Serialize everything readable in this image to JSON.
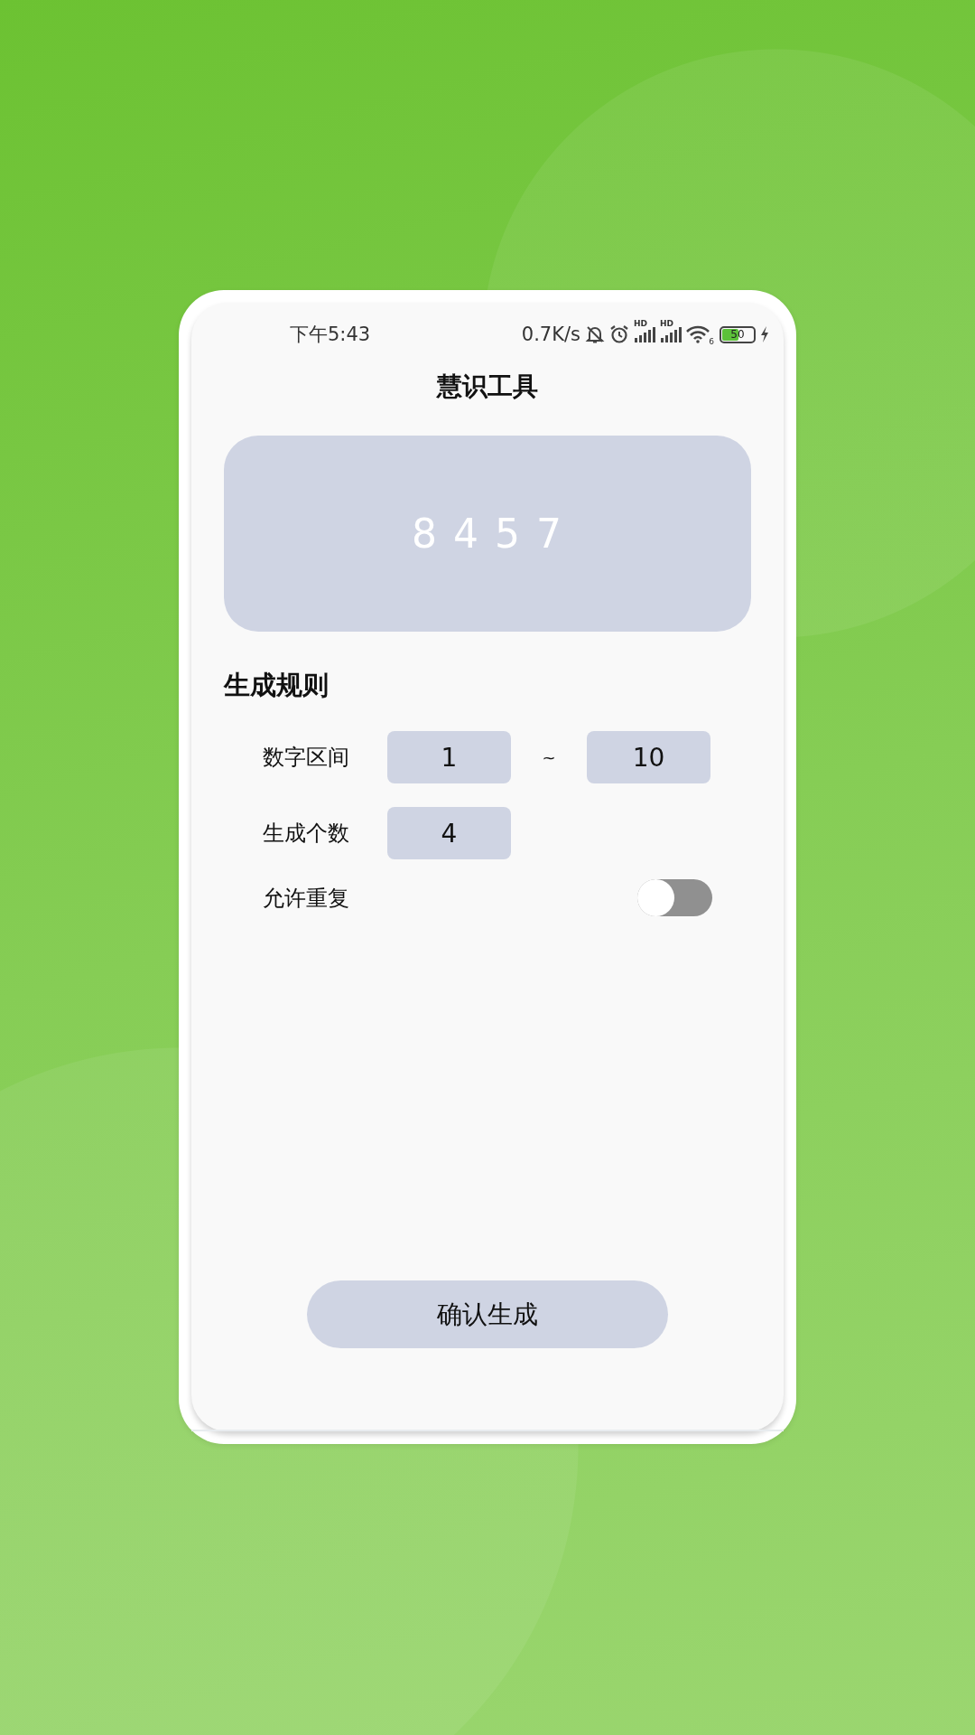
{
  "status_bar": {
    "time": "下午5:43",
    "network_speed": "0.7K/s",
    "signals": [
      {
        "label": "HD"
      },
      {
        "label": "HD"
      }
    ],
    "wifi_label": "6",
    "battery": "50",
    "charging": true
  },
  "title": "慧识工具",
  "result": {
    "digits": "8 4 5 7"
  },
  "section_title": "生成规则",
  "rows": [
    {
      "kind": "range",
      "label": "数字区间",
      "min": "1",
      "separator": "~",
      "max": "10"
    },
    {
      "kind": "number",
      "label": "生成个数",
      "value": "4"
    },
    {
      "kind": "toggle",
      "label": "允许重复",
      "on": false
    }
  ],
  "confirm_button": "确认生成"
}
